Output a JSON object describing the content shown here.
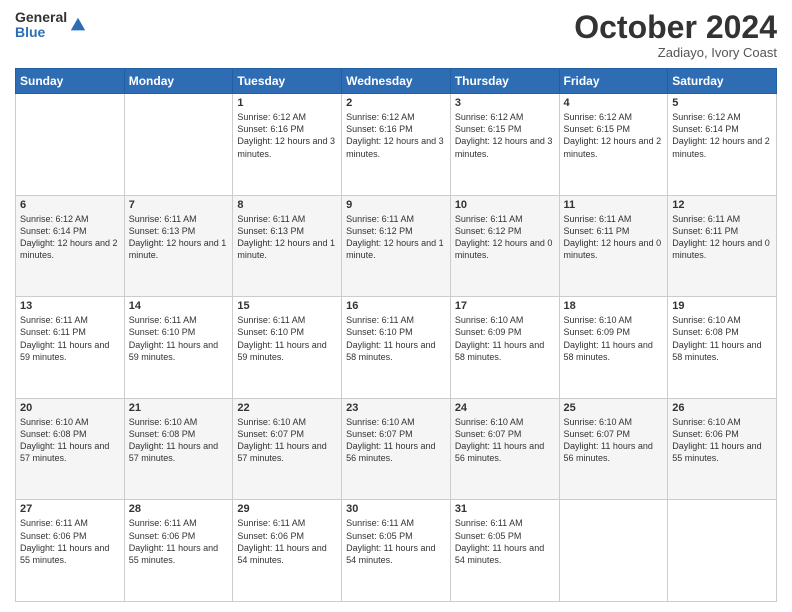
{
  "header": {
    "logo_line1": "General",
    "logo_line2": "Blue",
    "month": "October 2024",
    "location": "Zadiayo, Ivory Coast"
  },
  "days_of_week": [
    "Sunday",
    "Monday",
    "Tuesday",
    "Wednesday",
    "Thursday",
    "Friday",
    "Saturday"
  ],
  "weeks": [
    [
      {
        "day": "",
        "info": ""
      },
      {
        "day": "",
        "info": ""
      },
      {
        "day": "1",
        "info": "Sunrise: 6:12 AM\nSunset: 6:16 PM\nDaylight: 12 hours and 3 minutes."
      },
      {
        "day": "2",
        "info": "Sunrise: 6:12 AM\nSunset: 6:16 PM\nDaylight: 12 hours and 3 minutes."
      },
      {
        "day": "3",
        "info": "Sunrise: 6:12 AM\nSunset: 6:15 PM\nDaylight: 12 hours and 3 minutes."
      },
      {
        "day": "4",
        "info": "Sunrise: 6:12 AM\nSunset: 6:15 PM\nDaylight: 12 hours and 2 minutes."
      },
      {
        "day": "5",
        "info": "Sunrise: 6:12 AM\nSunset: 6:14 PM\nDaylight: 12 hours and 2 minutes."
      }
    ],
    [
      {
        "day": "6",
        "info": "Sunrise: 6:12 AM\nSunset: 6:14 PM\nDaylight: 12 hours and 2 minutes."
      },
      {
        "day": "7",
        "info": "Sunrise: 6:11 AM\nSunset: 6:13 PM\nDaylight: 12 hours and 1 minute."
      },
      {
        "day": "8",
        "info": "Sunrise: 6:11 AM\nSunset: 6:13 PM\nDaylight: 12 hours and 1 minute."
      },
      {
        "day": "9",
        "info": "Sunrise: 6:11 AM\nSunset: 6:12 PM\nDaylight: 12 hours and 1 minute."
      },
      {
        "day": "10",
        "info": "Sunrise: 6:11 AM\nSunset: 6:12 PM\nDaylight: 12 hours and 0 minutes."
      },
      {
        "day": "11",
        "info": "Sunrise: 6:11 AM\nSunset: 6:11 PM\nDaylight: 12 hours and 0 minutes."
      },
      {
        "day": "12",
        "info": "Sunrise: 6:11 AM\nSunset: 6:11 PM\nDaylight: 12 hours and 0 minutes."
      }
    ],
    [
      {
        "day": "13",
        "info": "Sunrise: 6:11 AM\nSunset: 6:11 PM\nDaylight: 11 hours and 59 minutes."
      },
      {
        "day": "14",
        "info": "Sunrise: 6:11 AM\nSunset: 6:10 PM\nDaylight: 11 hours and 59 minutes."
      },
      {
        "day": "15",
        "info": "Sunrise: 6:11 AM\nSunset: 6:10 PM\nDaylight: 11 hours and 59 minutes."
      },
      {
        "day": "16",
        "info": "Sunrise: 6:11 AM\nSunset: 6:10 PM\nDaylight: 11 hours and 58 minutes."
      },
      {
        "day": "17",
        "info": "Sunrise: 6:10 AM\nSunset: 6:09 PM\nDaylight: 11 hours and 58 minutes."
      },
      {
        "day": "18",
        "info": "Sunrise: 6:10 AM\nSunset: 6:09 PM\nDaylight: 11 hours and 58 minutes."
      },
      {
        "day": "19",
        "info": "Sunrise: 6:10 AM\nSunset: 6:08 PM\nDaylight: 11 hours and 58 minutes."
      }
    ],
    [
      {
        "day": "20",
        "info": "Sunrise: 6:10 AM\nSunset: 6:08 PM\nDaylight: 11 hours and 57 minutes."
      },
      {
        "day": "21",
        "info": "Sunrise: 6:10 AM\nSunset: 6:08 PM\nDaylight: 11 hours and 57 minutes."
      },
      {
        "day": "22",
        "info": "Sunrise: 6:10 AM\nSunset: 6:07 PM\nDaylight: 11 hours and 57 minutes."
      },
      {
        "day": "23",
        "info": "Sunrise: 6:10 AM\nSunset: 6:07 PM\nDaylight: 11 hours and 56 minutes."
      },
      {
        "day": "24",
        "info": "Sunrise: 6:10 AM\nSunset: 6:07 PM\nDaylight: 11 hours and 56 minutes."
      },
      {
        "day": "25",
        "info": "Sunrise: 6:10 AM\nSunset: 6:07 PM\nDaylight: 11 hours and 56 minutes."
      },
      {
        "day": "26",
        "info": "Sunrise: 6:10 AM\nSunset: 6:06 PM\nDaylight: 11 hours and 55 minutes."
      }
    ],
    [
      {
        "day": "27",
        "info": "Sunrise: 6:11 AM\nSunset: 6:06 PM\nDaylight: 11 hours and 55 minutes."
      },
      {
        "day": "28",
        "info": "Sunrise: 6:11 AM\nSunset: 6:06 PM\nDaylight: 11 hours and 55 minutes."
      },
      {
        "day": "29",
        "info": "Sunrise: 6:11 AM\nSunset: 6:06 PM\nDaylight: 11 hours and 54 minutes."
      },
      {
        "day": "30",
        "info": "Sunrise: 6:11 AM\nSunset: 6:05 PM\nDaylight: 11 hours and 54 minutes."
      },
      {
        "day": "31",
        "info": "Sunrise: 6:11 AM\nSunset: 6:05 PM\nDaylight: 11 hours and 54 minutes."
      },
      {
        "day": "",
        "info": ""
      },
      {
        "day": "",
        "info": ""
      }
    ]
  ]
}
